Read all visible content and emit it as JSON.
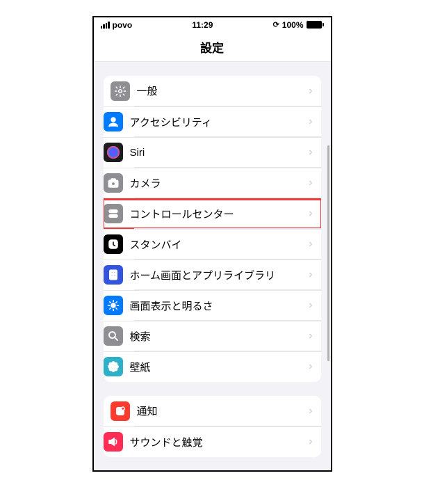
{
  "status": {
    "carrier": "povo",
    "time": "11:29",
    "battery": "100%"
  },
  "navbar": {
    "title": "設定"
  },
  "groups": [
    {
      "items": [
        {
          "id": "general",
          "label": "一般",
          "icon": {
            "bg": "#8e8e93",
            "glyph": "gear"
          }
        },
        {
          "id": "accessibility",
          "label": "アクセシビリティ",
          "icon": {
            "bg": "#007aff",
            "glyph": "person"
          }
        },
        {
          "id": "siri",
          "label": "Siri",
          "icon": {
            "bg": "#1c1c1e",
            "glyph": "siri"
          }
        },
        {
          "id": "camera",
          "label": "カメラ",
          "icon": {
            "bg": "#8e8e93",
            "glyph": "camera"
          }
        },
        {
          "id": "control-center",
          "label": "コントロールセンター",
          "icon": {
            "bg": "#8e8e93",
            "glyph": "toggles"
          },
          "highlighted": true
        },
        {
          "id": "standby",
          "label": "スタンバイ",
          "icon": {
            "bg": "#000000",
            "glyph": "clock"
          }
        },
        {
          "id": "home-screen",
          "label": "ホーム画面とアプリライブラリ",
          "icon": {
            "bg": "#3355dd",
            "glyph": "grid"
          }
        },
        {
          "id": "display",
          "label": "画面表示と明るさ",
          "icon": {
            "bg": "#007aff",
            "glyph": "brightness"
          }
        },
        {
          "id": "search",
          "label": "検索",
          "icon": {
            "bg": "#8e8e93",
            "glyph": "search"
          }
        },
        {
          "id": "wallpaper",
          "label": "壁紙",
          "icon": {
            "bg": "#30b0c7",
            "glyph": "flower"
          }
        }
      ]
    },
    {
      "items": [
        {
          "id": "notifications",
          "label": "通知",
          "icon": {
            "bg": "#ff3b30",
            "glyph": "bell"
          }
        },
        {
          "id": "sounds",
          "label": "サウンドと触覚",
          "icon": {
            "bg": "#ff2d55",
            "glyph": "speaker"
          }
        }
      ]
    }
  ]
}
